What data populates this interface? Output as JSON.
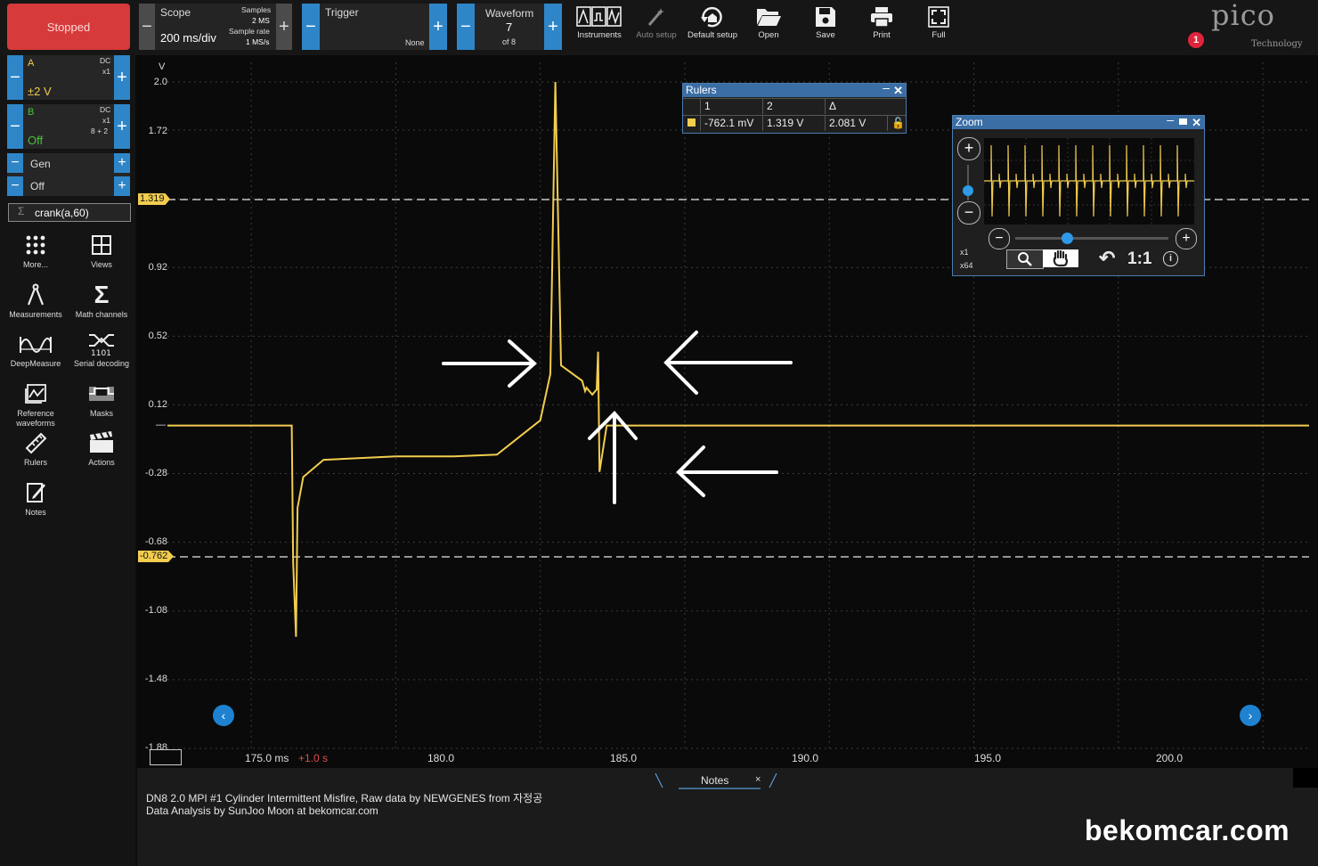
{
  "toolbar": {
    "stop_label": "Stopped",
    "scope": {
      "title": "Scope",
      "timebase": "200 ms/div",
      "samples_label": "Samples",
      "samples_value": "2 MS",
      "rate_label": "Sample rate",
      "rate_value": "1 MS/s"
    },
    "trigger": {
      "title": "Trigger",
      "mode": "None"
    },
    "waveform": {
      "title": "Waveform",
      "current": "7",
      "of_label": "of 8"
    },
    "tools": [
      "Instruments",
      "Auto setup",
      "Default setup",
      "Open",
      "Save",
      "Print",
      "Full"
    ],
    "brand": "pico",
    "brand_sub": "Technology",
    "alert_count": "1"
  },
  "channels": {
    "a": {
      "name": "A",
      "coupling": "DC",
      "probe": "x1",
      "range": "±2 V"
    },
    "b": {
      "name": "B",
      "coupling": "DC",
      "probe": "x1",
      "extra": "8 + 2",
      "range": "Off"
    },
    "gen": {
      "name": "Gen",
      "state": "Off"
    },
    "math_expr": "crank(a,60)"
  },
  "side_tools": [
    "More...",
    "Views",
    "Measurements",
    "Math channels",
    "DeepMeasure",
    "Serial decoding",
    "Reference waveforms",
    "Masks",
    "Rulers",
    "Actions",
    "Notes"
  ],
  "chart_data": {
    "type": "line",
    "ylabel": "V",
    "yticks": [
      "2.0",
      "1.72",
      "0.92",
      "0.52",
      "0.12",
      "-0.28",
      "-0.68",
      "-1.08",
      "-1.48",
      "-1.88"
    ],
    "xticks": [
      "175.0 ms",
      "180.0",
      "185.0",
      "190.0",
      "195.0",
      "200.0"
    ],
    "x_offset": "+1.0 s",
    "ruler_1": "1.319",
    "ruler_2": "-0.762",
    "ylim": [
      -1.88,
      2.0
    ],
    "xlim": [
      172.1,
      211.6
    ],
    "series": [
      {
        "color": "#f2cd4e",
        "x": [
          172.1,
          176.4,
          176.45,
          176.55,
          176.6,
          176.8,
          177.5,
          180,
          182,
          183.5,
          184.4,
          185,
          185.35,
          185.52,
          185.72,
          186.45,
          186.55,
          186.6,
          186.8,
          186.95,
          187.0,
          187.05,
          187.3,
          211.6
        ],
        "y": [
          0.0,
          0.0,
          -0.8,
          -1.23,
          -0.48,
          -0.3,
          -0.2,
          -0.18,
          -0.18,
          -0.17,
          -0.05,
          0.03,
          0.3,
          2.0,
          0.35,
          0.26,
          0.2,
          0.22,
          0.18,
          0.21,
          0.43,
          -0.27,
          0.0,
          0.0
        ]
      }
    ]
  },
  "rulers": {
    "title": "Rulers",
    "col1": "1",
    "col2": "2",
    "col3": "Δ",
    "v1": "-762.1 mV",
    "v2": "1.319 V",
    "delta": "2.081 V"
  },
  "zoom": {
    "title": "Zoom",
    "x1": "x1",
    "x64": "x64",
    "ratio": "1:1"
  },
  "notes": {
    "tab": "Notes",
    "line1": "DN8 2.0 MPI #1 Cylinder Intermittent Misfire, Raw data by NEWGENES from 자정공",
    "line2": "Data Analysis by SunJoo Moon at bekomcar.com"
  },
  "watermark": "bekomcar.com"
}
